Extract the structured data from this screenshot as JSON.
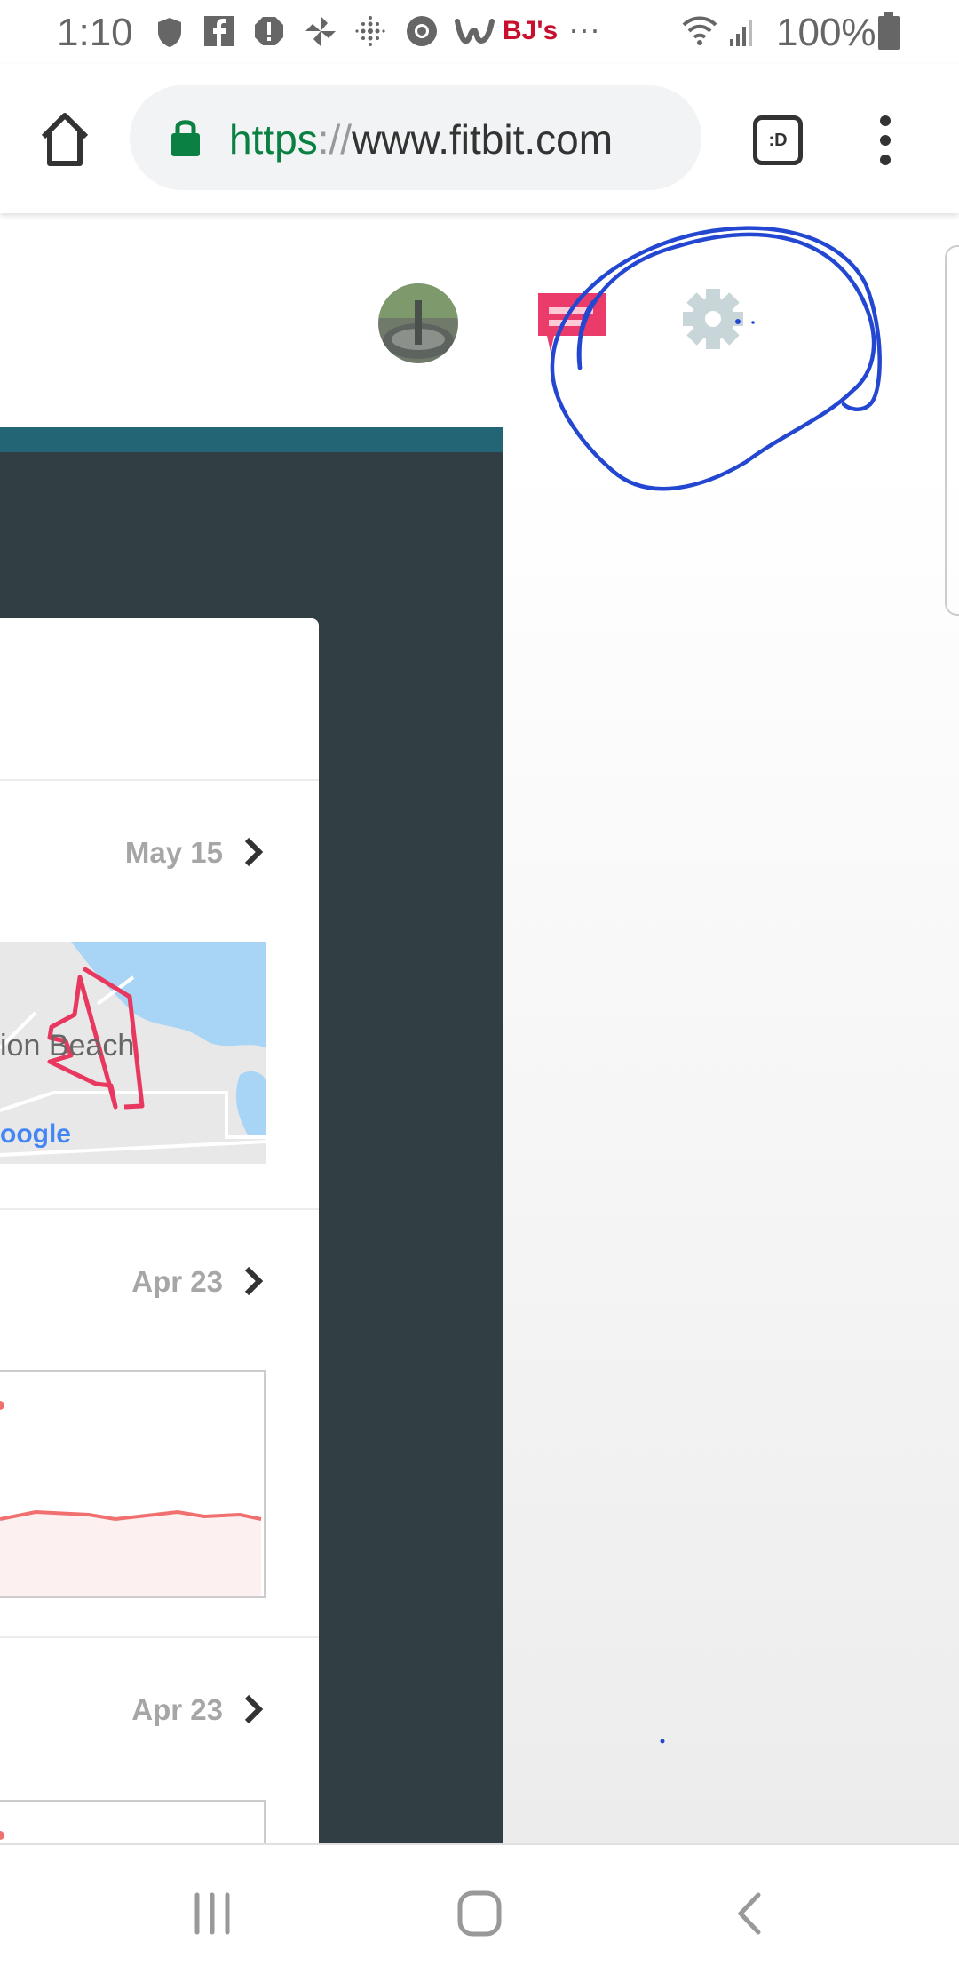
{
  "status_bar": {
    "time": "1:10",
    "notification_icons": [
      "shield-icon",
      "facebook-icon",
      "alert-icon",
      "pinwheel-icon",
      "fitbit-icon",
      "chrome-icon",
      "wish-icon",
      "bjs-icon",
      "more-icon"
    ],
    "bjs_label": "BJ's",
    "more": "···",
    "battery": "100%"
  },
  "browser": {
    "url_scheme": "https",
    "url_sep": "://",
    "url_host": "www.fitbit.com",
    "tab_switcher_label": ":D"
  },
  "header": {
    "icons": [
      "avatar",
      "messages-icon",
      "gear-icon"
    ],
    "accent": "#eb3b6a",
    "gear_color": "#c8d6d9"
  },
  "feed": {
    "items": [
      {
        "date": "May 15",
        "thumbnail": "map",
        "map_label": "ion Beach",
        "map_logo": "oogle"
      },
      {
        "date": "Apr 23",
        "thumbnail": "heart-rate-graph"
      },
      {
        "date": "Apr 23",
        "thumbnail": "heart-rate-graph"
      }
    ]
  },
  "annotation": {
    "color": "#2347d1",
    "shape": "hand-drawn-circle"
  },
  "nav_bar": {
    "buttons": [
      "recents",
      "home",
      "back"
    ]
  }
}
